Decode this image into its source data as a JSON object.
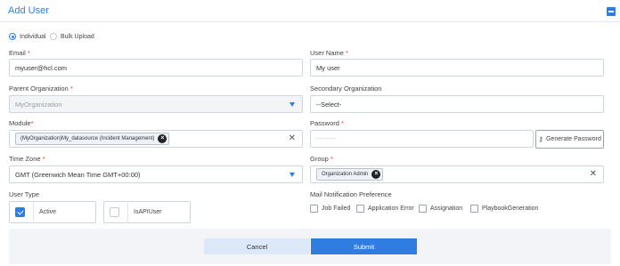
{
  "header": {
    "title": "Add User"
  },
  "mode": {
    "options": [
      "Individual",
      "Bulk Upload"
    ],
    "selected": "Individual"
  },
  "form": {
    "email": {
      "label": "Email",
      "value": "myuser@hcl.com"
    },
    "username": {
      "label": "User Name",
      "value": "My user"
    },
    "parent_org": {
      "label": "Parent Organization",
      "value": "MyOrganization"
    },
    "secondary_org": {
      "label": "Secondary Organization",
      "value": "--Select-"
    },
    "module": {
      "label": "Module",
      "chip": "(MyOrganization)My_datasource (Incident Management)"
    },
    "password": {
      "label": "Password",
      "value": "--------",
      "generate_label": "Generate Password"
    },
    "timezone": {
      "label": "Time Zone",
      "value": "GMT (Greenwich Mean Time GMT+00:00)"
    },
    "group": {
      "label": "Group",
      "chip": "Organization Admin"
    },
    "user_type": {
      "label": "User Type",
      "options": [
        {
          "label": "Active",
          "checked": true
        },
        {
          "label": "IsAPIUser",
          "checked": false
        }
      ]
    },
    "notifications": {
      "label": "Mail Notification Preference",
      "options": [
        "Job Failed",
        "Application Error",
        "Assignation",
        "PlaybookGeneration"
      ]
    }
  },
  "actions": {
    "cancel": "Cancel",
    "submit": "Submit"
  },
  "colors": {
    "accent": "#2f7de1",
    "required": "#e0463a"
  }
}
